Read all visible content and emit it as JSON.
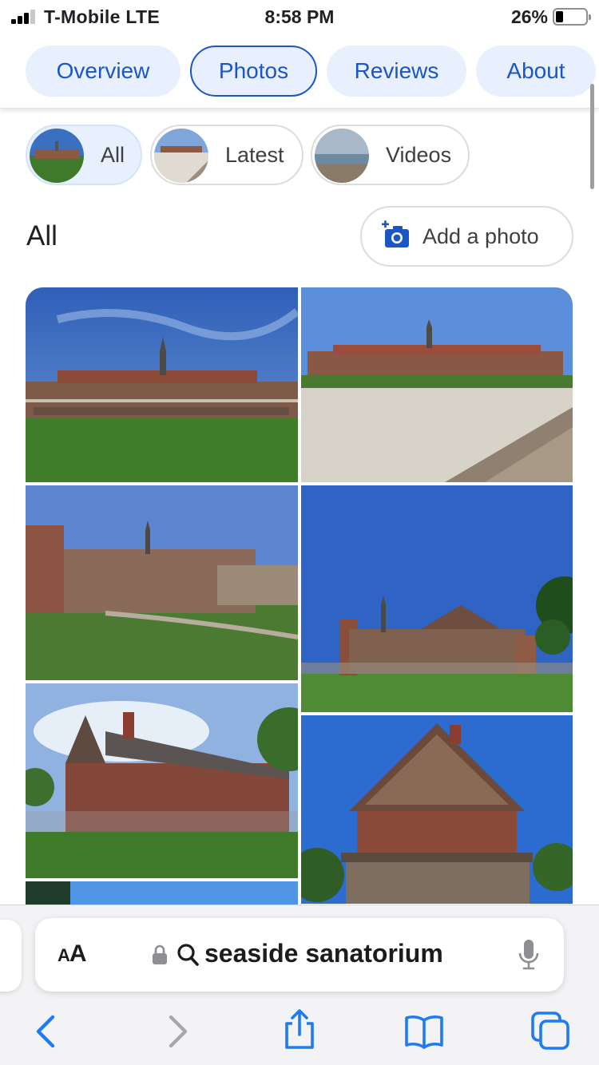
{
  "status_bar": {
    "carrier": "T-Mobile  LTE",
    "time": "8:58 PM",
    "battery_percent_text": "26%",
    "battery_level": 0.26,
    "signal_bars": 3
  },
  "tabs": [
    {
      "label": "Overview",
      "active": false
    },
    {
      "label": "Photos",
      "active": true
    },
    {
      "label": "Reviews",
      "active": false
    },
    {
      "label": "About",
      "active": false
    }
  ],
  "filter_chips": [
    {
      "label": "All",
      "selected": true
    },
    {
      "label": "Latest",
      "selected": false
    },
    {
      "label": "Videos",
      "selected": false
    }
  ],
  "section": {
    "title": "All",
    "add_photo_label": "Add a photo"
  },
  "photos": [
    {
      "subject": "large-sanatorium-building-lawn"
    },
    {
      "subject": "sanatorium-from-beach"
    },
    {
      "subject": "round-tower-wing"
    },
    {
      "subject": "building-blue-sky-tree"
    },
    {
      "subject": "brick-dormitory-wing"
    },
    {
      "subject": "gabled-brick-house"
    },
    {
      "subject": "partial-photo"
    }
  ],
  "safari": {
    "aa_label_big": "A",
    "aa_label_small": "A",
    "url_text": "seaside sanatorium",
    "toolbar": [
      "back",
      "forward",
      "share",
      "bookmarks",
      "tabs"
    ]
  },
  "colors": {
    "accent": "#1a56c6",
    "tab_bg": "#e8f0fe",
    "safari_blue": "#1e7bf2"
  }
}
